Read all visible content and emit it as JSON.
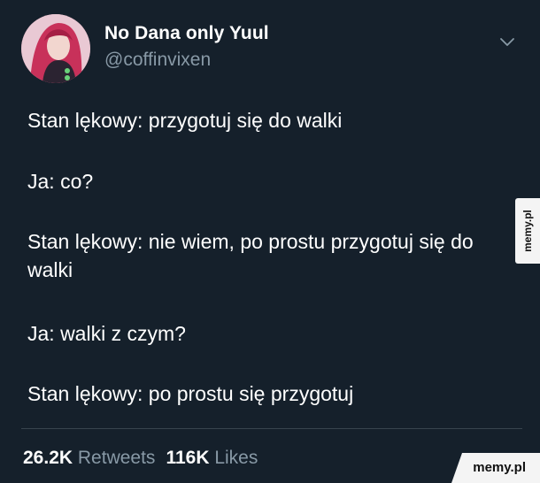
{
  "user": {
    "display_name": "No Dana only Yuul",
    "handle": "@coffinvixen"
  },
  "tweet": {
    "lines": [
      "Stan lękowy: przygotuj się do walki",
      "Ja: co?",
      "Stan lękowy: nie wiem, po prostu przygotuj się do walki",
      "Ja: walki z czym?",
      "Stan lękowy: po prostu się przygotuj"
    ]
  },
  "stats": {
    "retweets_count": "26.2K",
    "retweets_label": "Retweets",
    "likes_count": "116K",
    "likes_label": "Likes"
  },
  "watermarks": {
    "side": "memy.pl",
    "corner": "memy.pl"
  },
  "icons": {
    "menu": "chevron-down-icon",
    "avatar": "avatar"
  },
  "colors": {
    "background": "#15202b",
    "text": "#ffffff",
    "secondary": "#8899a6",
    "divider": "#38444d"
  }
}
